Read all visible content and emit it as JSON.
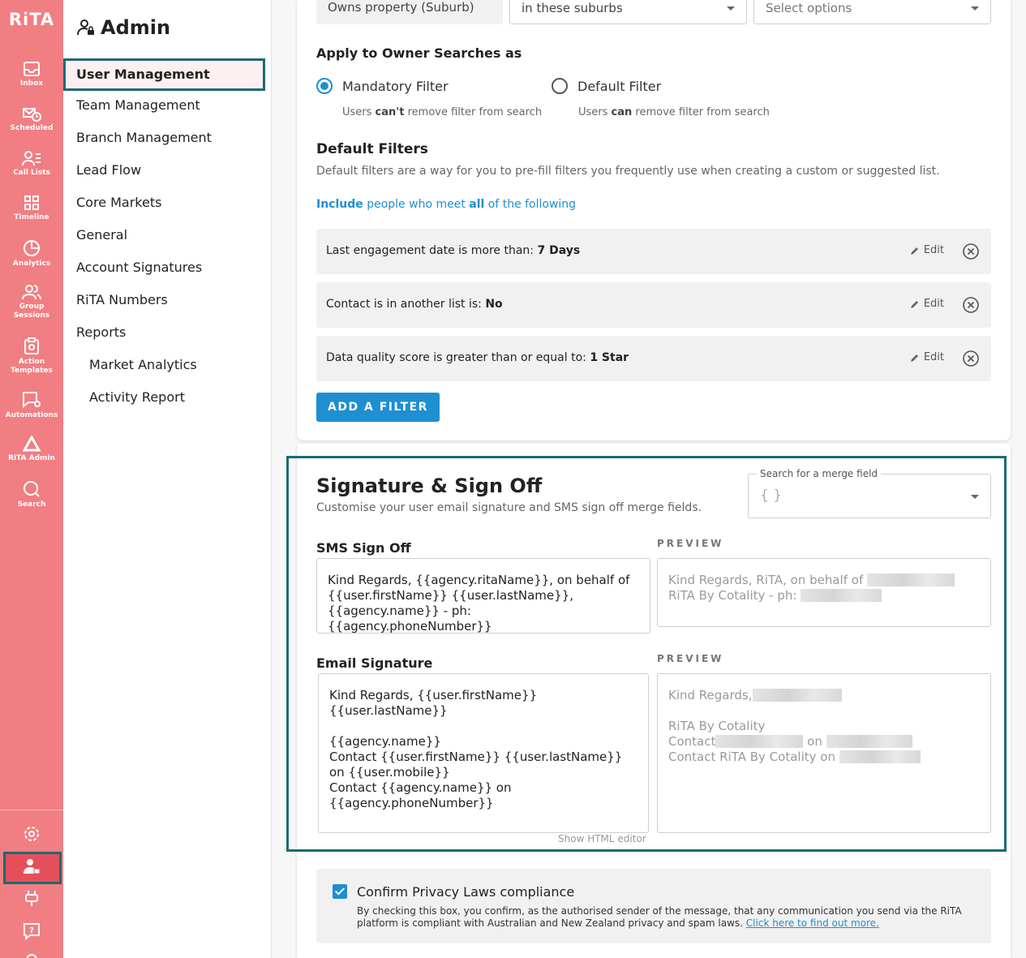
{
  "rail": {
    "logo": "RiTA",
    "items": [
      {
        "label": "Inbox",
        "icon": "inbox-icon"
      },
      {
        "label": "Scheduled",
        "icon": "scheduled-icon"
      },
      {
        "label": "Call Lists",
        "icon": "call-lists-icon"
      },
      {
        "label": "Timeline",
        "icon": "timeline-icon"
      },
      {
        "label": "Analytics",
        "icon": "analytics-icon"
      },
      {
        "label": "Group Sessions",
        "icon": "group-sessions-icon"
      },
      {
        "label": "Action Templates",
        "icon": "action-templates-icon"
      },
      {
        "label": "Automations",
        "icon": "automations-icon"
      },
      {
        "label": "RiTA Admin",
        "icon": "rita-admin-icon"
      },
      {
        "label": "Search",
        "icon": "search-icon"
      }
    ],
    "bottom": [
      "settings-icon",
      "admin-user-icon",
      "plug-icon",
      "help-icon"
    ],
    "colors": {
      "rail": "#f17e83",
      "active": "#e44f5a",
      "highlight": "#1c6b72"
    }
  },
  "sidebar": {
    "title": "Admin",
    "items": [
      {
        "label": "User Management",
        "active": true
      },
      {
        "label": "Team Management"
      },
      {
        "label": "Branch Management"
      },
      {
        "label": "Lead Flow"
      },
      {
        "label": "Core Markets"
      },
      {
        "label": "General"
      },
      {
        "label": "Account Signatures"
      },
      {
        "label": "RiTA Numbers"
      },
      {
        "label": "Reports"
      },
      {
        "label": "Market Analytics",
        "sub": true
      },
      {
        "label": "Activity Report",
        "sub": true
      }
    ]
  },
  "criteria": {
    "field": "Owns property (Suburb)",
    "operator": "in these suburbs",
    "value_placeholder": "Select options"
  },
  "apply": {
    "heading": "Apply to Owner Searches as",
    "mandatory": {
      "label": "Mandatory Filter",
      "hint_pre": "Users ",
      "hint_bold": "can't",
      "hint_post": " remove filter from search",
      "selected": true
    },
    "default": {
      "label": "Default Filter",
      "hint_pre": "Users ",
      "hint_bold": "can",
      "hint_post": " remove filter from search",
      "selected": false
    }
  },
  "default_filters": {
    "heading": "Default Filters",
    "description": "Default filters are a way for you to pre-fill filters you frequently use when creating a custom or suggested list.",
    "include_pre": "Include",
    "include_mid": " people who meet ",
    "include_all": "all",
    "include_post": " of the following",
    "rows": [
      {
        "text": "Last engagement date is more than: ",
        "value": "7 Days"
      },
      {
        "text": "Contact is in another list is: ",
        "value": "No"
      },
      {
        "text": "Data quality score is greater than or equal to: ",
        "value": "1 Star"
      }
    ],
    "edit_label": "Edit",
    "add_button": "ADD A FILTER"
  },
  "signature": {
    "title": "Signature & Sign Off",
    "subtitle": "Customise your user email signature and SMS sign off merge fields.",
    "merge_label": "Search for a merge field",
    "merge_value": "{ }",
    "sms_label": "SMS Sign Off",
    "preview_label": "PREVIEW",
    "sms_text": "Kind Regards, {{agency.ritaName}}, on behalf of {{user.firstName}} {{user.lastName}}, {{agency.name}} - ph: {{agency.phoneNumber}}",
    "sms_preview_1": "Kind Regards, RiTA, on behalf of",
    "sms_preview_2": "RiTA By Cotality - ph:",
    "email_label": "Email Signature",
    "email_text": "Kind Regards, {{user.firstName}}\n{{user.lastName}}\n\n{{agency.name}}\nContact {{user.firstName}} {{user.lastName}} on {{user.mobile}}\nContact {{agency.name}} on\n{{agency.phoneNumber}}",
    "email_preview_1": "Kind Regards,",
    "email_preview_2": "RiTA By Cotality",
    "email_preview_3": "Contact",
    "email_preview_3b": "on",
    "email_preview_4": "Contact RiTA By Cotality on",
    "html_editor": "Show HTML editor"
  },
  "privacy": {
    "title": "Confirm Privacy Laws compliance",
    "body": "By checking this box, you confirm, as the authorised sender of the message, that any communication you send via the RiTA platform is compliant with Australian and New Zealand privacy and spam laws. ",
    "link": "Click here to find out more.",
    "checked": true
  }
}
